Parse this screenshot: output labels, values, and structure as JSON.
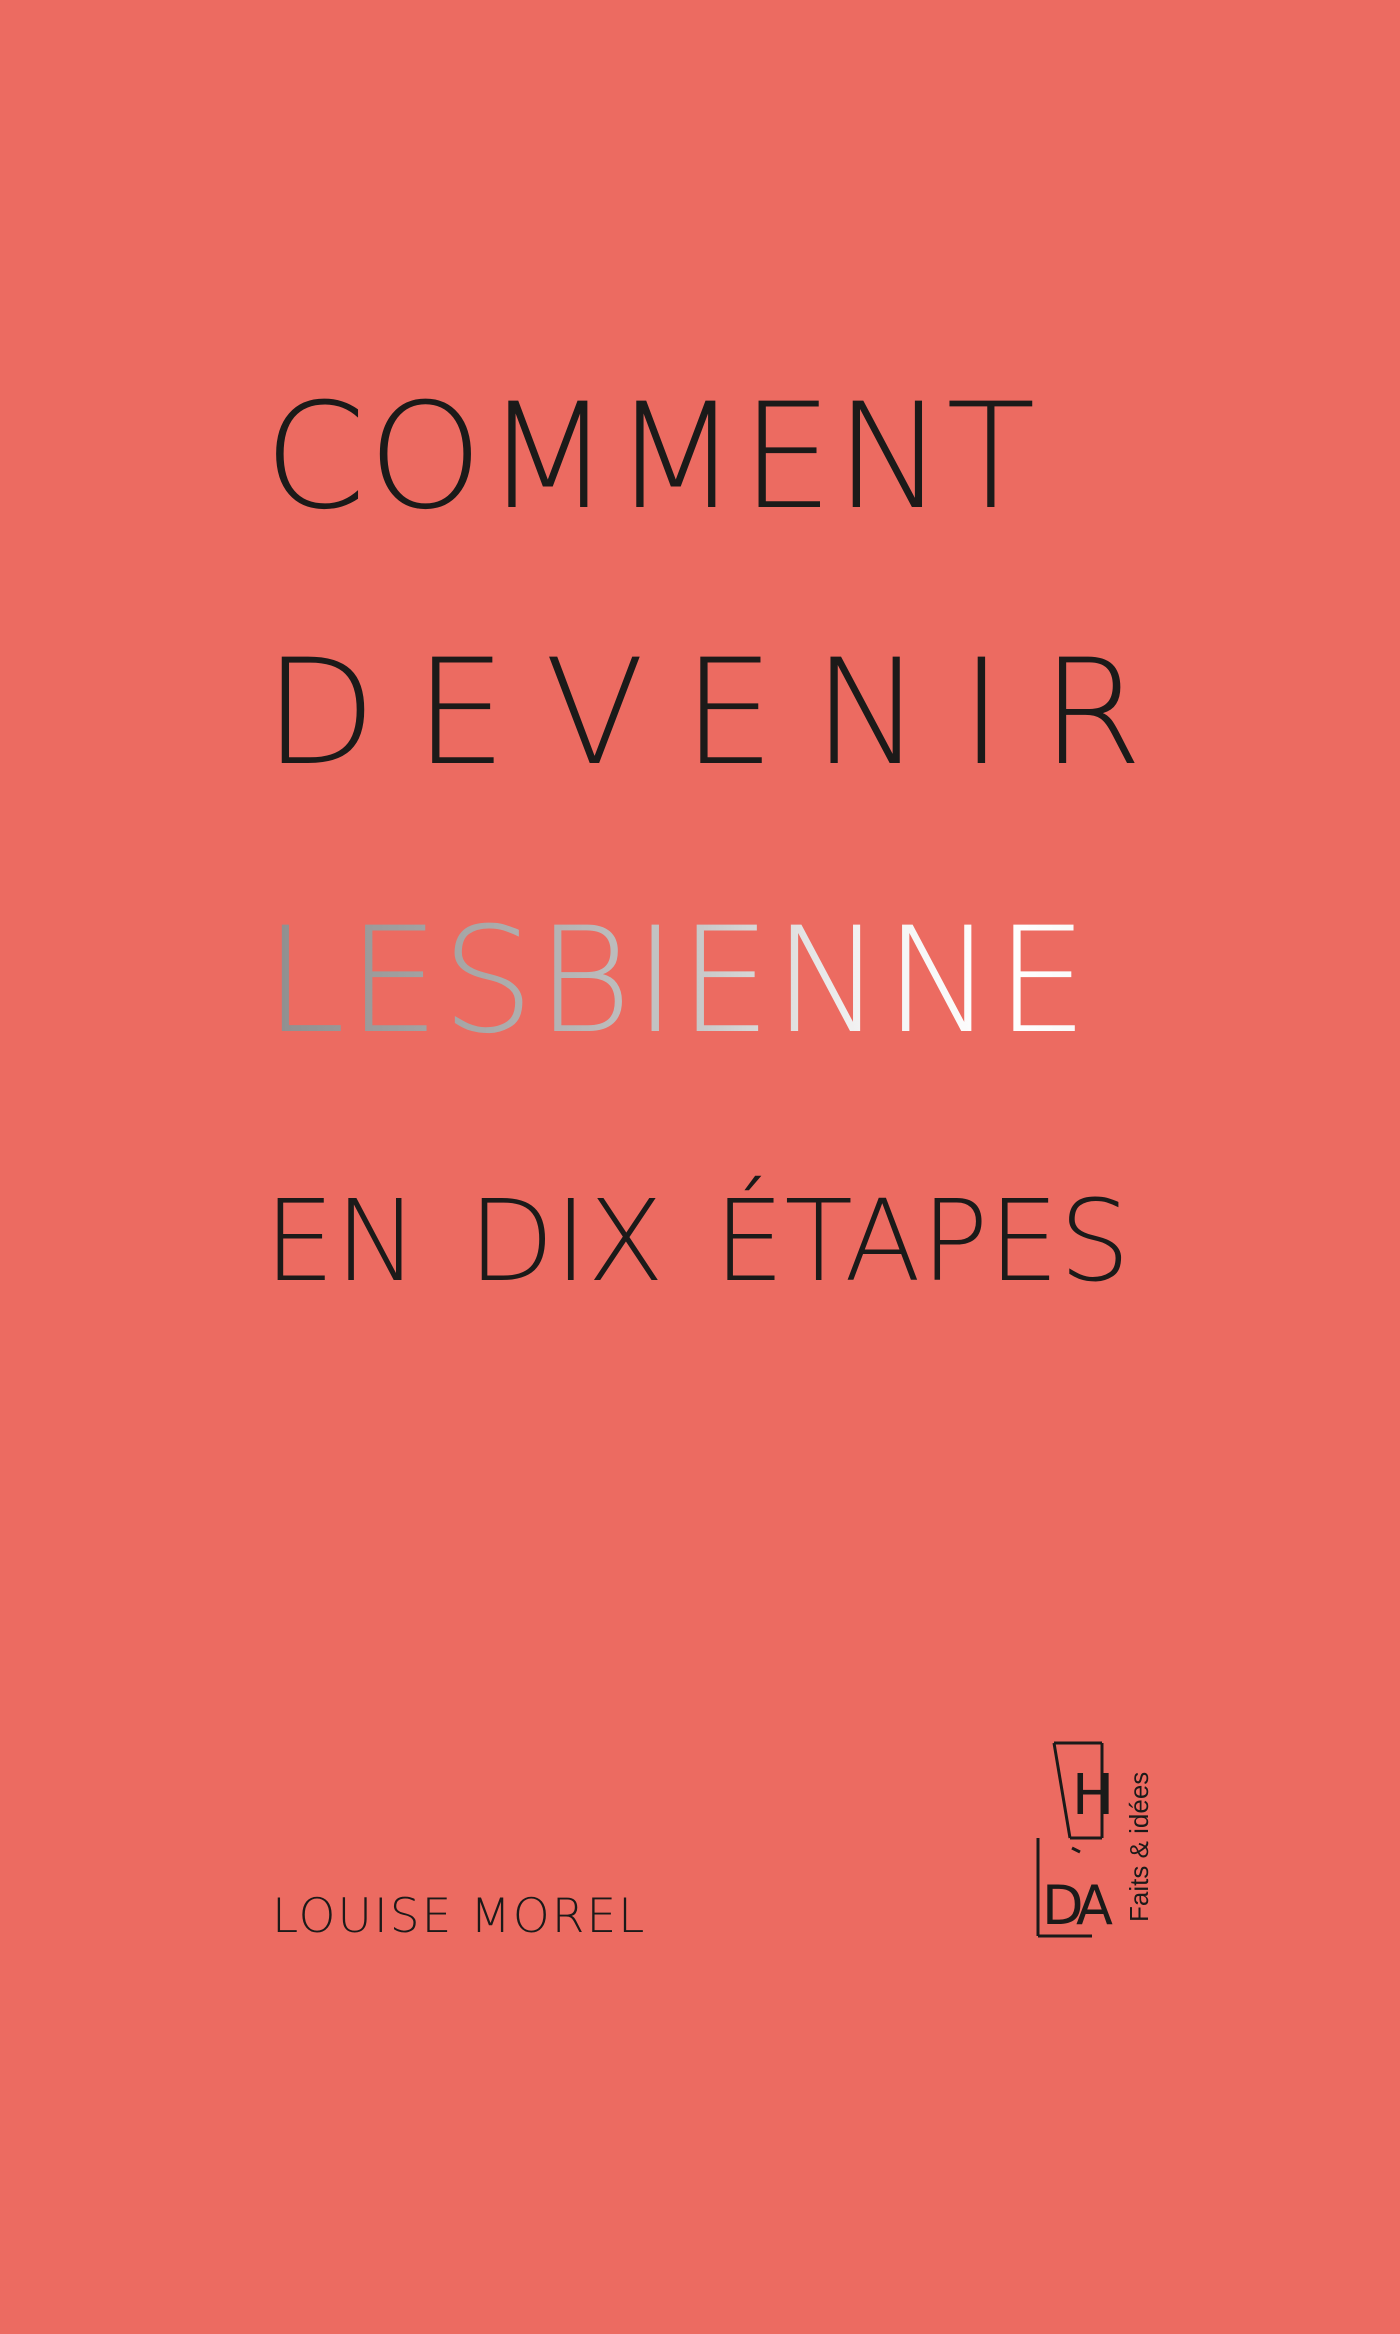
{
  "cover": {
    "background_color": "#ec6b61",
    "text_color": "#1b1a19",
    "title_lines": [
      "COMMENT",
      "DEVENIR",
      "LESBIENNE",
      "EN DIX ÉTAPES"
    ],
    "highlight_word_style": "silver foil",
    "author": "LOUISE MOREL",
    "publisher": {
      "logo_letters": {
        "top": "H",
        "bottom_left": "D",
        "bottom_right": "A"
      },
      "collection": "Faits & idées"
    }
  }
}
